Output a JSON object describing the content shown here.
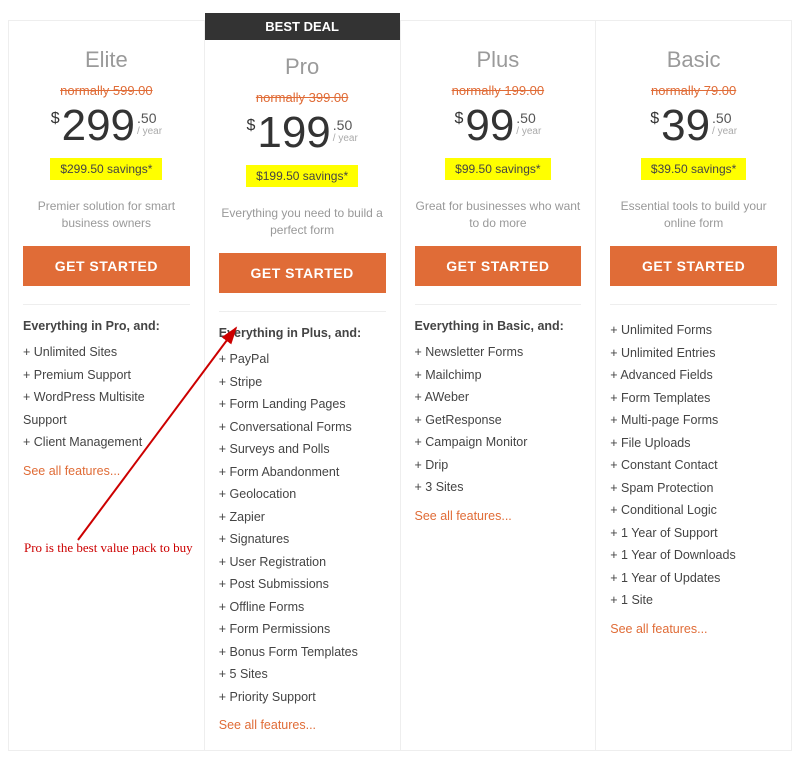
{
  "best_deal_label": "BEST DEAL",
  "annotation_text": "Pro is the best value pack to buy",
  "tiers": [
    {
      "name": "Elite",
      "normally": "normally 599.00",
      "price": "299",
      "cents": ".50",
      "per": "/ year",
      "savings": "$299.50 savings*",
      "desc": "Premier solution for smart business owners",
      "cta": "GET STARTED",
      "feat_head": "Everything in Pro, and:",
      "features": [
        "+ Unlimited Sites",
        "+ Premium Support",
        "+ WordPress Multisite Support",
        "+ Client Management"
      ],
      "see_all": "See all features..."
    },
    {
      "name": "Pro",
      "normally": "normally 399.00",
      "price": "199",
      "cents": ".50",
      "per": "/ year",
      "savings": "$199.50 savings*",
      "desc": "Everything you need to build a perfect form",
      "cta": "GET STARTED",
      "feat_head": "Everything in Plus, and:",
      "features": [
        "+ PayPal",
        "+ Stripe",
        "+ Form Landing Pages",
        "+ Conversational Forms",
        "+ Surveys and Polls",
        "+ Form Abandonment",
        "+ Geolocation",
        "+ Zapier",
        "+ Signatures",
        "+ User Registration",
        "+ Post Submissions",
        "+ Offline Forms",
        "+ Form Permissions",
        "+ Bonus Form Templates",
        "+ 5 Sites",
        "+ Priority Support"
      ],
      "see_all": "See all features..."
    },
    {
      "name": "Plus",
      "normally": "normally 199.00",
      "price": "99",
      "cents": ".50",
      "per": "/ year",
      "savings": "$99.50 savings*",
      "desc": "Great for businesses who want to do more",
      "cta": "GET STARTED",
      "feat_head": "Everything in Basic, and:",
      "features": [
        "+ Newsletter Forms",
        "+ Mailchimp",
        "+ AWeber",
        "+ GetResponse",
        "+ Campaign Monitor",
        "+ Drip",
        "+ 3 Sites"
      ],
      "see_all": "See all features..."
    },
    {
      "name": "Basic",
      "normally": "normally 79.00",
      "price": "39",
      "cents": ".50",
      "per": "/ year",
      "savings": "$39.50 savings*",
      "desc": "Essential tools to build your online form",
      "cta": "GET STARTED",
      "feat_head": "",
      "features": [
        "+ Unlimited Forms",
        "+ Unlimited Entries",
        "+ Advanced Fields",
        "+ Form Templates",
        "+ Multi-page Forms",
        "+ File Uploads",
        "+ Constant Contact",
        "+ Spam Protection",
        "+ Conditional Logic",
        "+ 1 Year of Support",
        "+ 1 Year of Downloads",
        "+ 1 Year of Updates",
        "+ 1 Site"
      ],
      "see_all": "See all features..."
    }
  ]
}
